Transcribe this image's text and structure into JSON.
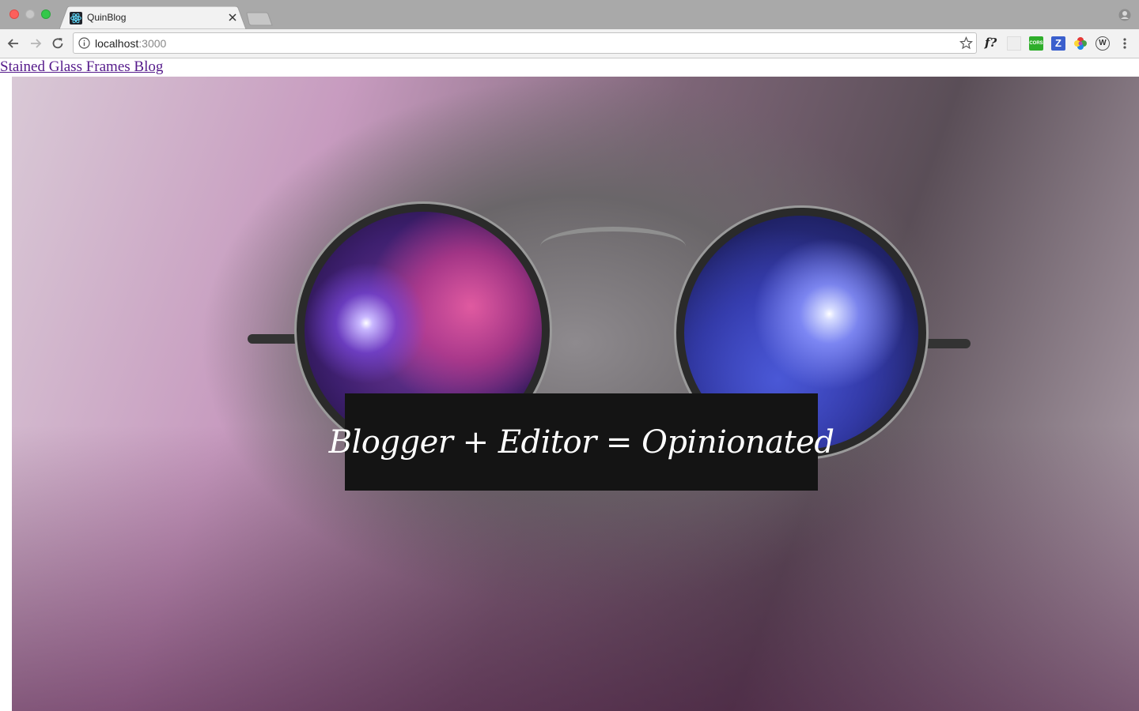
{
  "browser": {
    "tab": {
      "title": "QuinBlog",
      "favicon": "react-atom-icon"
    },
    "address_bar": {
      "host": "localhost",
      "port": ":3000"
    },
    "extensions": [
      {
        "name": "f-question-extension-icon",
        "label": "f?"
      },
      {
        "name": "grid-extension-icon",
        "label": ""
      },
      {
        "name": "cors-extension-icon",
        "label": "CORS"
      },
      {
        "name": "z-extension-icon",
        "label": "Z"
      },
      {
        "name": "color-wheel-extension-icon",
        "label": ""
      },
      {
        "name": "w-extension-icon",
        "label": "W"
      }
    ]
  },
  "page": {
    "nav_link": "Stained Glass Frames Blog",
    "hero": {
      "caption": "Blogger + Editor = Opinionated",
      "image_subject": "cat-with-galaxy-glasses"
    }
  },
  "colors": {
    "link": "#551a8b",
    "caption_bg": "#141414",
    "caption_text": "#ffffff"
  }
}
